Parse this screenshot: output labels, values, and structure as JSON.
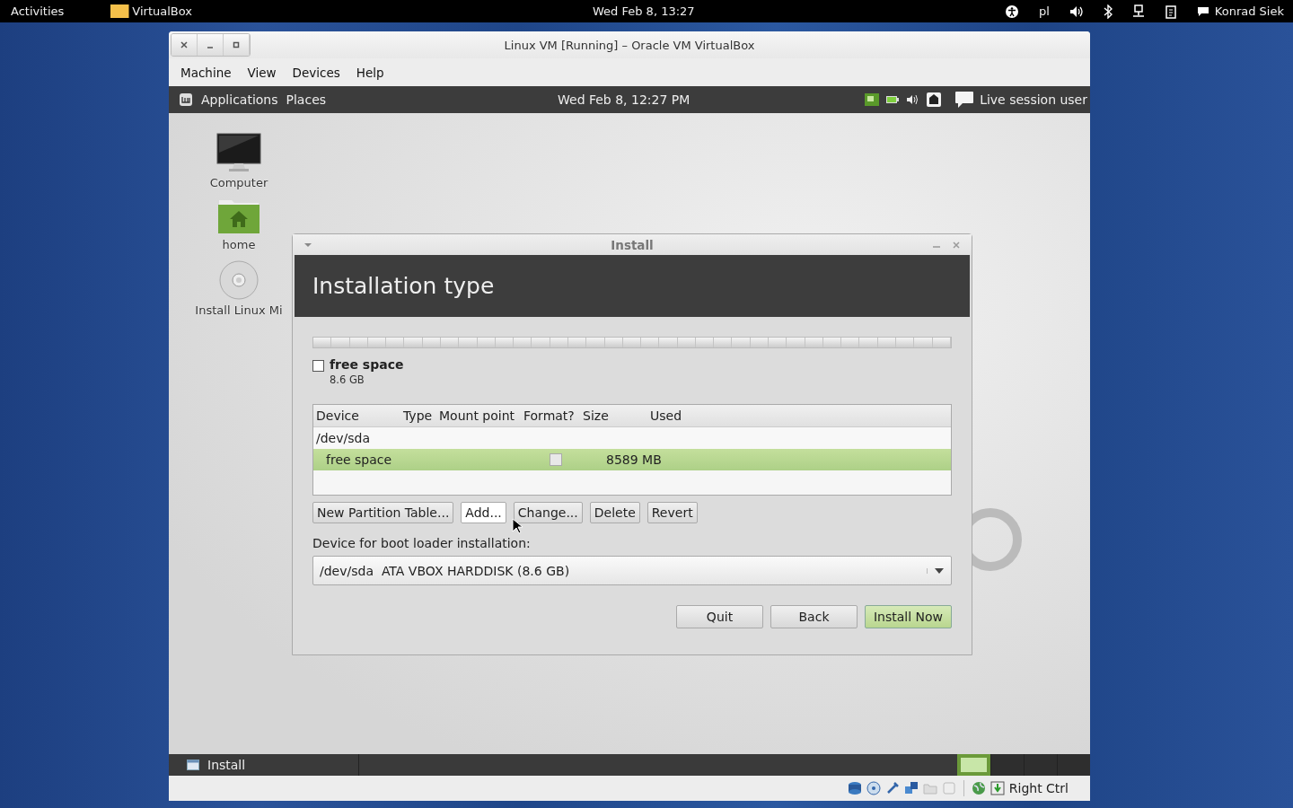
{
  "top_bar": {
    "activities": "Activities",
    "app_name": "VirtualBox",
    "clock": "Wed Feb  8, 13:27",
    "keyboard": "pl",
    "user": "Konrad Siek"
  },
  "vbox_window": {
    "title": "Linux VM [Running] – Oracle VM VirtualBox",
    "menu": [
      "Machine",
      "View",
      "Devices",
      "Help"
    ],
    "guest_panel": {
      "applications": "Applications",
      "places": "Places",
      "clock": "Wed Feb  8, 12:27 PM",
      "user": "Live session user"
    },
    "desktop_icons": [
      {
        "kind": "computer",
        "label": "Computer"
      },
      {
        "kind": "home",
        "label": "home"
      },
      {
        "kind": "disc",
        "label": "Install Linux Mi"
      }
    ],
    "install_dialog": {
      "title": "Install",
      "heading": "Installation type",
      "partition": {
        "name": "free space",
        "size": "8.6 GB",
        "checked": false
      },
      "table": {
        "columns": [
          "Device",
          "Type",
          "Mount point",
          "Format?",
          "Size",
          "Used"
        ],
        "rows": [
          {
            "device": "/dev/sda",
            "selected": false,
            "indent": false
          },
          {
            "device": "free space",
            "format": false,
            "size": "8589 MB",
            "selected": true,
            "indent": true
          }
        ]
      },
      "buttons": [
        {
          "label": "New Partition Table...",
          "hover": false
        },
        {
          "label": "Add...",
          "hover": true
        },
        {
          "label": "Change...",
          "hover": false
        },
        {
          "label": "Delete",
          "hover": false
        },
        {
          "label": "Revert",
          "hover": false
        }
      ],
      "boot_label": "Device for boot loader installation:",
      "boot_device": "/dev/sda  ATA VBOX HARDDISK (8.6 GB)",
      "actions": [
        {
          "label": "Quit",
          "default": false
        },
        {
          "label": "Back",
          "default": false
        },
        {
          "label": "Install Now",
          "default": true
        }
      ]
    },
    "taskbar": {
      "task": "Install",
      "workspaces": [
        {
          "selected": true
        },
        {
          "selected": false
        },
        {
          "selected": false
        },
        {
          "selected": false
        }
      ]
    },
    "status_bar": {
      "host_key": "Right Ctrl"
    }
  }
}
